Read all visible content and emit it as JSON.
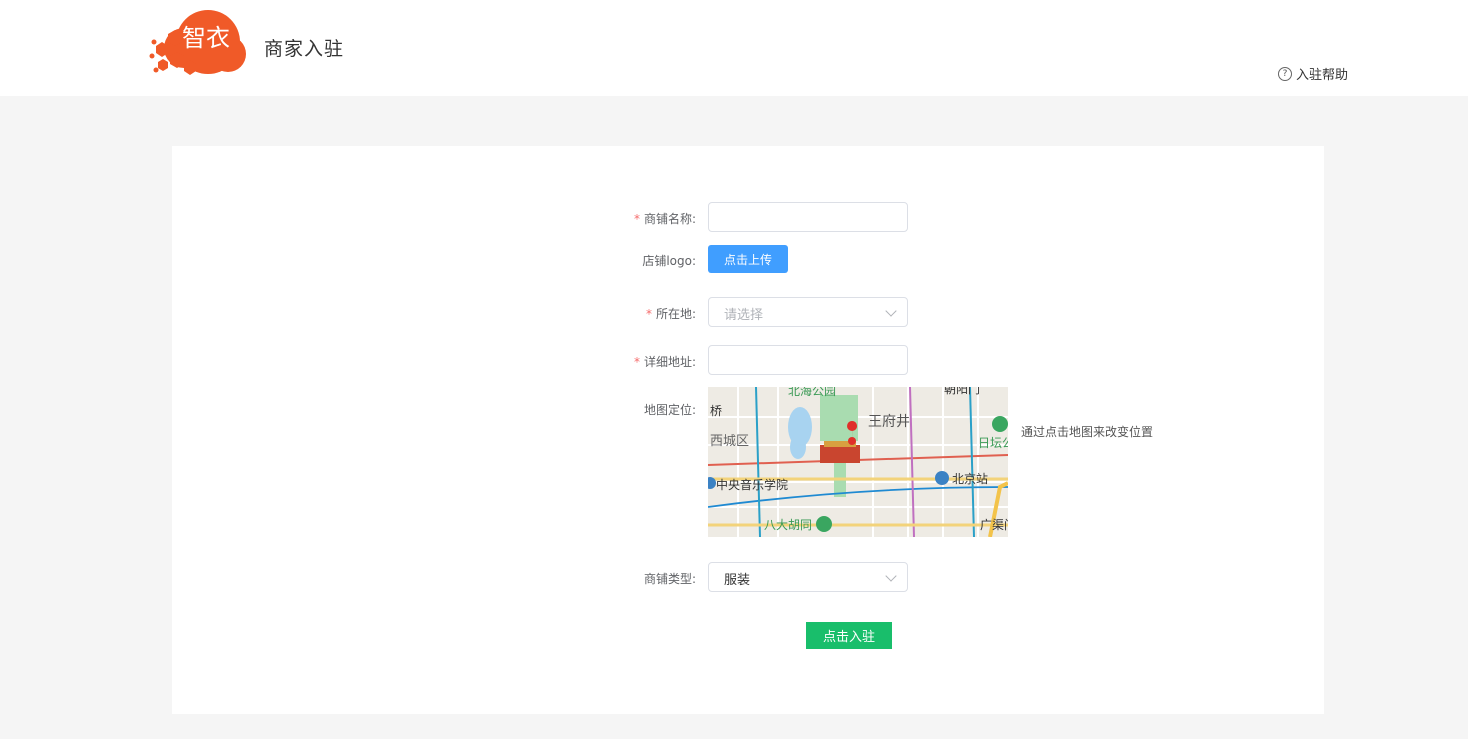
{
  "header": {
    "logo_text": "智衣",
    "title": "商家入驻",
    "help_label": "入驻帮助"
  },
  "form": {
    "shop_name": {
      "label": "商铺名称:",
      "required": true,
      "value": ""
    },
    "shop_logo": {
      "label": "店铺logo:",
      "button_label": "点击上传"
    },
    "location": {
      "label": "所在地:",
      "required": true,
      "placeholder": "请选择"
    },
    "address": {
      "label": "详细地址:",
      "required": true,
      "value": ""
    },
    "map": {
      "label": "地图定位:",
      "hint": "通过点击地图来改变位置",
      "places": [
        "北海公园",
        "王府井",
        "西城区",
        "日坛公",
        "北京站",
        "中央音乐学院",
        "八大胡同",
        "广渠门",
        "桥",
        "朝阳门"
      ]
    },
    "shop_type": {
      "label": "商铺类型:",
      "value": "服装"
    },
    "submit_label": "点击入驻"
  },
  "colors": {
    "primary_blue": "#409eff",
    "submit_green": "#19be6b",
    "logo_orange": "#f05a28",
    "required_red": "#f56c6c"
  }
}
